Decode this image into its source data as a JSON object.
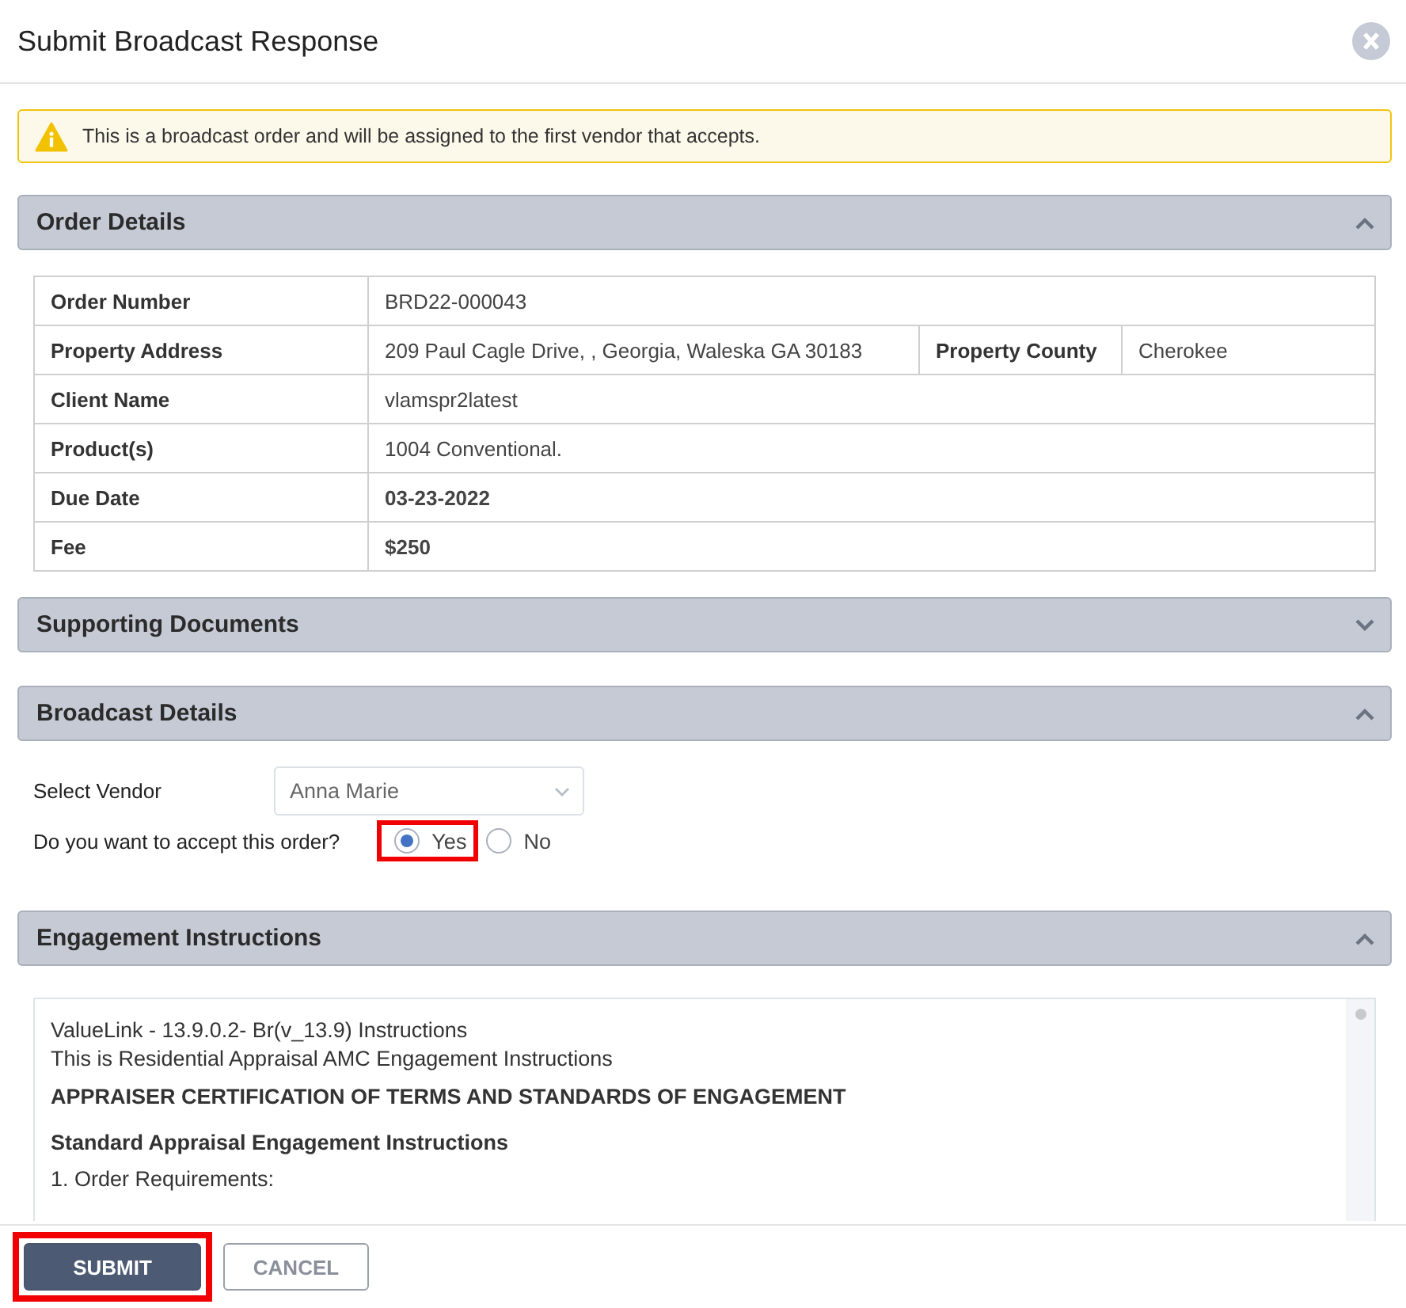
{
  "dialog": {
    "title": "Submit Broadcast Response"
  },
  "alert": {
    "text": "This is a broadcast order and will be assigned to the first vendor that accepts."
  },
  "order_details": {
    "title": "Order Details",
    "expanded": true,
    "rows": [
      {
        "label": "Order Number",
        "value": "BRD22-000043",
        "bold": false
      },
      {
        "label": "Property Address",
        "value": "209 Paul Cagle Drive, , Georgia, Waleska GA 30183",
        "bold": false,
        "extra_label": "Property County",
        "extra_value": "Cherokee"
      },
      {
        "label": "Client Name",
        "value": "vlamspr2latest",
        "bold": false
      },
      {
        "label": "Product(s)",
        "value": "1004 Conventional.",
        "bold": false
      },
      {
        "label": "Due Date",
        "value": "03-23-2022",
        "bold": true
      },
      {
        "label": "Fee",
        "value": "$250",
        "bold": true
      }
    ]
  },
  "supporting_documents": {
    "title": "Supporting Documents",
    "expanded": false
  },
  "broadcast_details": {
    "title": "Broadcast Details",
    "expanded": true,
    "vendor_label": "Select Vendor",
    "vendor_value": "Anna Marie",
    "question": "Do you want to accept this order?",
    "options": [
      {
        "label": "Yes",
        "selected": true,
        "highlighted": true
      },
      {
        "label": "No",
        "selected": false,
        "highlighted": false
      }
    ]
  },
  "engagement_instructions": {
    "title": "Engagement Instructions",
    "expanded": true,
    "lines": [
      {
        "kind": "plain",
        "text": "ValueLink - 13.9.0.2- Br(v_13.9) Instructions"
      },
      {
        "kind": "plain",
        "text": "This is Residential Appraisal AMC Engagement Instructions"
      },
      {
        "kind": "heading",
        "text": "APPRAISER CERTIFICATION OF TERMS AND STANDARDS OF ENGAGEMENT"
      },
      {
        "kind": "heading",
        "text": "Standard Appraisal Engagement Instructions"
      },
      {
        "kind": "plain",
        "text": "1. Order Requirements:"
      }
    ]
  },
  "buttons": [
    {
      "label": "SUBMIT",
      "kind": "primary",
      "highlighted": true
    },
    {
      "label": "CANCEL",
      "kind": "secondary",
      "highlighted": false
    }
  ]
}
